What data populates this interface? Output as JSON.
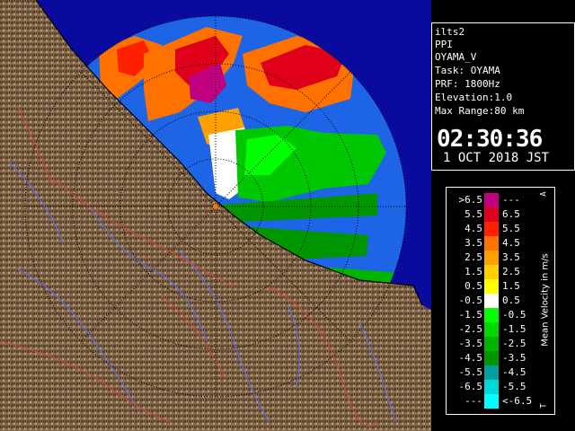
{
  "info": {
    "lines": [
      "ilts2",
      "PPI",
      "OYAMA_V",
      "Task: OYAMA",
      "PRF: 1800Hz",
      "Elevation:1.0",
      "Max Range:80 km"
    ],
    "time": "02:30:36",
    "date": "1 OCT 2018 JST"
  },
  "legend": {
    "title": "Mean Velocity in m/s",
    "corner_top": "A",
    "corner_bottom": "T",
    "rows": [
      {
        "lo": ">6.5",
        "hi": "---",
        "color": "#c0007f"
      },
      {
        "lo": "5.5",
        "hi": "6.5",
        "color": "#e0001a"
      },
      {
        "lo": "4.5",
        "hi": "5.5",
        "color": "#ff2000"
      },
      {
        "lo": "3.5",
        "hi": "4.5",
        "color": "#ff7200"
      },
      {
        "lo": "2.5",
        "hi": "3.5",
        "color": "#ffa000"
      },
      {
        "lo": "1.5",
        "hi": "2.5",
        "color": "#ffcf00"
      },
      {
        "lo": "0.5",
        "hi": "1.5",
        "color": "#ffff00"
      },
      {
        "lo": "-0.5",
        "hi": "0.5",
        "color": "#ffffff"
      },
      {
        "lo": "-1.5",
        "hi": "-0.5",
        "color": "#00ff00"
      },
      {
        "lo": "-2.5",
        "hi": "-1.5",
        "color": "#00d800"
      },
      {
        "lo": "-3.5",
        "hi": "-2.5",
        "color": "#00b400"
      },
      {
        "lo": "-4.5",
        "hi": "-3.5",
        "color": "#009600"
      },
      {
        "lo": "-5.5",
        "hi": "-4.5",
        "color": "#00a0a0"
      },
      {
        "lo": "-6.5",
        "hi": "-5.5",
        "color": "#00d8d8"
      },
      {
        "lo": "---",
        "hi": "<-6.5",
        "color": "#00ffff"
      }
    ]
  },
  "map": {
    "sea_color": "#0a0a9e",
    "coverage_color": "#1e64e6",
    "land_color": "#7d6548"
  }
}
